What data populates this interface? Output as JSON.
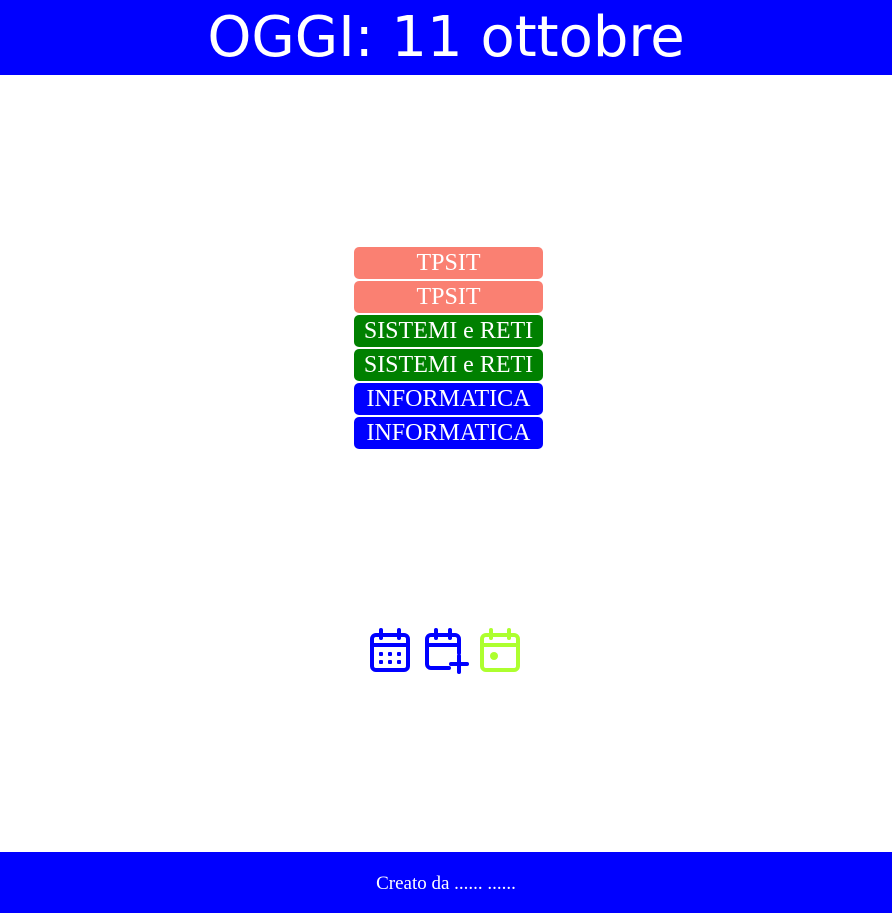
{
  "header": {
    "title": "OGGI: 11 ottobre"
  },
  "schedule": {
    "lessons": [
      {
        "label": "TPSIT",
        "color": "#fa8072"
      },
      {
        "label": "TPSIT",
        "color": "#fa8072"
      },
      {
        "label": "SISTEMI e RETI",
        "color": "#008000"
      },
      {
        "label": "SISTEMI e RETI",
        "color": "#008000"
      },
      {
        "label": "INFORMATICA",
        "color": "#0000ff"
      },
      {
        "label": "INFORMATICA",
        "color": "#0000ff"
      }
    ]
  },
  "toolbar": {
    "icons": [
      {
        "name": "calendar-grid-icon",
        "color": "#0000ff"
      },
      {
        "name": "calendar-add-icon",
        "color": "#0000ff"
      },
      {
        "name": "calendar-today-icon",
        "color": "#adff2f"
      }
    ]
  },
  "footer": {
    "text": "Creato da ...... ......"
  }
}
